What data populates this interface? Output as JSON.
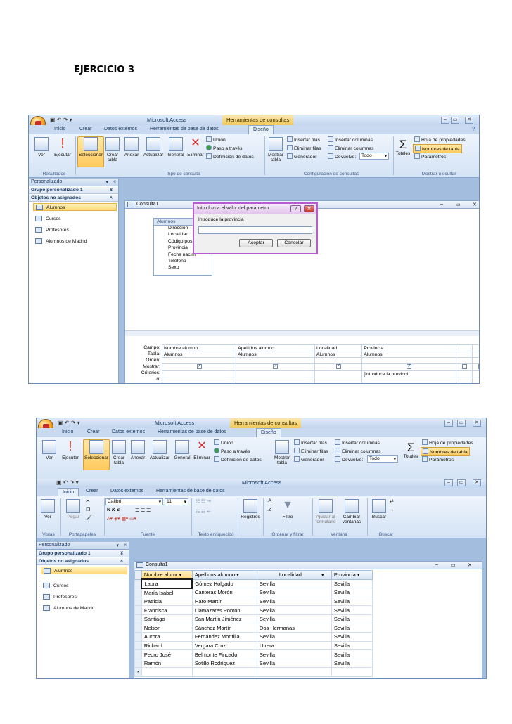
{
  "doc": {
    "title": "EJERCICIO 3"
  },
  "shot1": {
    "app_title": "Microsoft Access",
    "context_tab": "Herramientas de consultas",
    "tabs": [
      "Inicio",
      "Crear",
      "Datos externos",
      "Herramientas de base de datos",
      "Diseño"
    ],
    "ribbon": {
      "ver": "Ver",
      "ejecutar": "Ejecutar",
      "seleccionar": "Seleccionar",
      "crear_tabla_1": "Crear",
      "crear_tabla_2": "tabla",
      "anexar": "Anexar",
      "actualizar": "Actualizar",
      "general": "General",
      "eliminar": "Eliminar",
      "union": "Unión",
      "paso_traves": "Paso a través",
      "definicion": "Definición de datos",
      "mostrar_tabla_1": "Mostrar",
      "mostrar_tabla_2": "tabla",
      "insertar_filas": "Insertar filas",
      "eliminar_filas": "Eliminar filas",
      "generador": "Generador",
      "insertar_columnas": "Insertar columnas",
      "eliminar_columnas": "Eliminar columnas",
      "devuelve": "Devuelve:",
      "devuelve_value": "Todo",
      "totales": "Totales",
      "hoja_propiedades": "Hoja de propiedades",
      "nombres_tabla": "Nombres de tabla",
      "parametros": "Parámetros",
      "grp_resultados": "Resultados",
      "grp_tipo": "Tipo de consulta",
      "grp_config": "Configuración de consultas",
      "grp_mostrar": "Mostrar u ocultar"
    },
    "nav": {
      "header": "Personalizado",
      "group1": "Grupo personalizado 1",
      "group2": "Objetos no asignados",
      "items": [
        "Alumnos",
        "Cursos",
        "Profesores",
        "Alumnos de Madrid"
      ]
    },
    "query_tab": "Consulta1",
    "field_list": {
      "title": "Alumnos",
      "fields": [
        "Dirección",
        "Localidad",
        "Código pos",
        "Provincia",
        "Fecha nacim",
        "Teléfono",
        "Sexo"
      ]
    },
    "dialog": {
      "title": "Introduzca el valor del parámetro",
      "prompt": "Introduce la provincia",
      "ok": "Aceptar",
      "cancel": "Cancelar"
    },
    "grid": {
      "labels": [
        "Campo:",
        "Tabla:",
        "Orden:",
        "Mostrar:",
        "Criterios:",
        "o:"
      ],
      "columns": [
        {
          "campo": "Nombre alumno",
          "tabla": "Alumnos",
          "criterio": ""
        },
        {
          "campo": "Apellidos alumno",
          "tabla": "Alumnos",
          "criterio": ""
        },
        {
          "campo": "Localidad",
          "tabla": "Alumnos",
          "criterio": ""
        },
        {
          "campo": "Provincia",
          "tabla": "Alumnos",
          "criterio": "[Introduce la provinci"
        }
      ]
    }
  },
  "shot2": {
    "app_title": "Microsoft Access",
    "context_tab": "Herramientas de consultas",
    "inner_title": "Microsoft Access",
    "tabs": [
      "Inicio",
      "Crear",
      "Datos externos",
      "Herramientas de base de datos",
      "Diseño"
    ],
    "inner_tabs": [
      "Inicio",
      "Crear",
      "Datos externos",
      "Herramientas de base de datos"
    ],
    "home_ribbon": {
      "ver": "Ver",
      "pegar": "Pegar",
      "font_name": "Calibri",
      "font_size": "11",
      "registros": "Registros",
      "filtro": "Filtro",
      "ajustar_1": "Ajustar al",
      "ajustar_2": "formulario",
      "cambiar_1": "Cambiar",
      "cambiar_2": "ventanas",
      "buscar": "Buscar",
      "grp_vistas": "Vistas",
      "grp_portapapeles": "Portapapeles",
      "grp_fuente": "Fuente",
      "grp_texto": "Texto enriquecido",
      "grp_ordenar": "Ordenar y filtrar",
      "grp_ventana": "Ventana",
      "grp_buscar": "Buscar"
    },
    "nav": {
      "header": "Personalizado",
      "group1": "Grupo personalizado 1",
      "group2": "Objetos no asignados",
      "items": [
        "Alumnos",
        "Cursos",
        "Profesores",
        "Alumnos de Madrid"
      ]
    },
    "query_tab": "Consulta1",
    "datasheet": {
      "headers": [
        "Nombre alumr",
        "Apellidos alumno",
        "Localidad",
        "Provincia"
      ],
      "rows": [
        [
          "Laura",
          "Gómez Holgado",
          "Sevilla",
          "Sevilla"
        ],
        [
          "María Isabel",
          "Canteras Morón",
          "Sevilla",
          "Sevilla"
        ],
        [
          "Patricia",
          "Haro Martín",
          "Sevilla",
          "Sevilla"
        ],
        [
          "Francisca",
          "Llamazares Pontón",
          "Sevilla",
          "Sevilla"
        ],
        [
          "Santiago",
          "San Martín Jiménez",
          "Sevilla",
          "Sevilla"
        ],
        [
          "Nelson",
          "Sánchez Martín",
          "Dos Hermanas",
          "Sevilla"
        ],
        [
          "Aurora",
          "Fernández Montilla",
          "Sevilla",
          "Sevilla"
        ],
        [
          "Richard",
          "Vergara Cruz",
          "Utrera",
          "Sevilla"
        ],
        [
          "Pedro José",
          "Belmonte Fincado",
          "Sevilla",
          "Sevilla"
        ],
        [
          "Ramón",
          "Sotillo Rodríguez",
          "Sevilla",
          "Sevilla"
        ]
      ],
      "new_row_marker": "*"
    }
  }
}
